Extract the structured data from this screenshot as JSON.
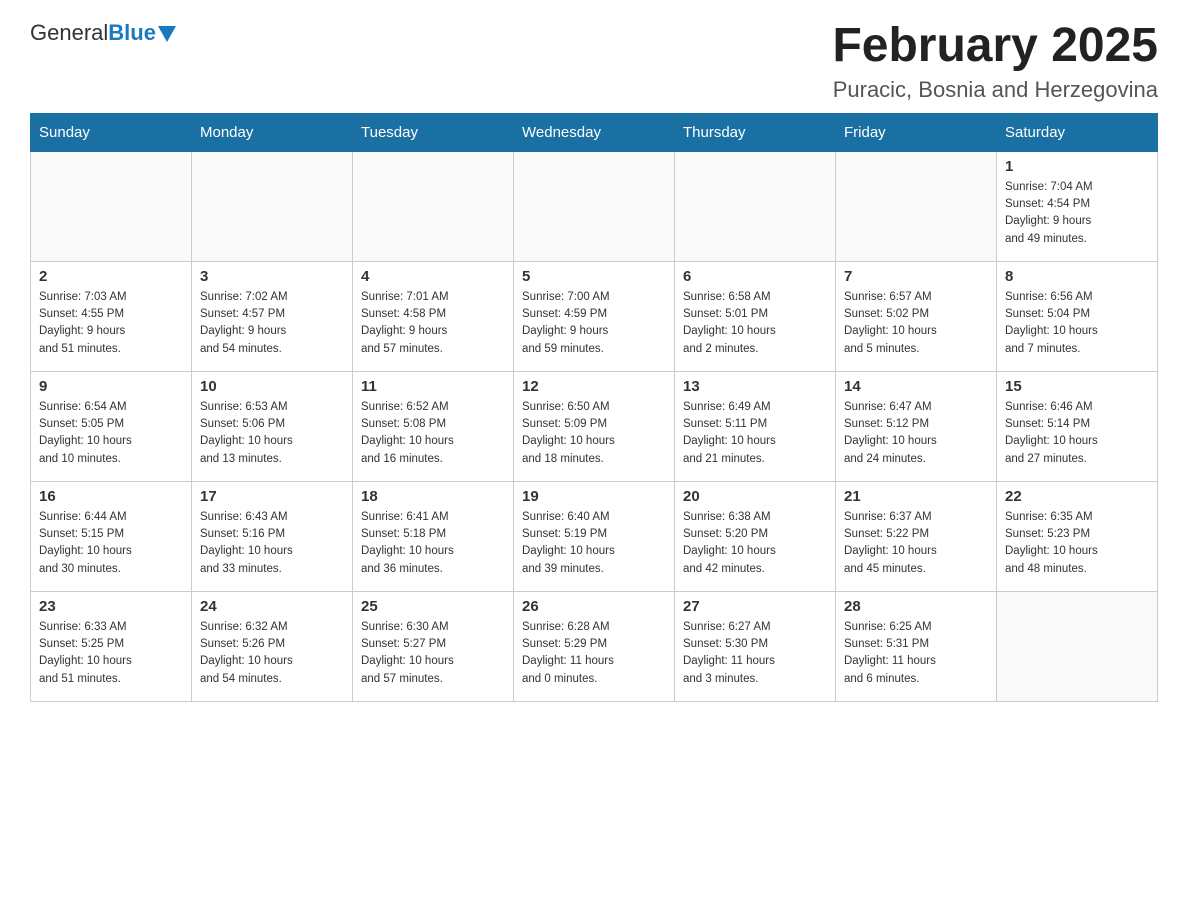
{
  "header": {
    "logo_general": "General",
    "logo_blue": "Blue",
    "title": "February 2025",
    "subtitle": "Puracic, Bosnia and Herzegovina"
  },
  "days_of_week": [
    "Sunday",
    "Monday",
    "Tuesday",
    "Wednesday",
    "Thursday",
    "Friday",
    "Saturday"
  ],
  "weeks": [
    {
      "days": [
        {
          "number": "",
          "info": ""
        },
        {
          "number": "",
          "info": ""
        },
        {
          "number": "",
          "info": ""
        },
        {
          "number": "",
          "info": ""
        },
        {
          "number": "",
          "info": ""
        },
        {
          "number": "",
          "info": ""
        },
        {
          "number": "1",
          "info": "Sunrise: 7:04 AM\nSunset: 4:54 PM\nDaylight: 9 hours\nand 49 minutes."
        }
      ]
    },
    {
      "days": [
        {
          "number": "2",
          "info": "Sunrise: 7:03 AM\nSunset: 4:55 PM\nDaylight: 9 hours\nand 51 minutes."
        },
        {
          "number": "3",
          "info": "Sunrise: 7:02 AM\nSunset: 4:57 PM\nDaylight: 9 hours\nand 54 minutes."
        },
        {
          "number": "4",
          "info": "Sunrise: 7:01 AM\nSunset: 4:58 PM\nDaylight: 9 hours\nand 57 minutes."
        },
        {
          "number": "5",
          "info": "Sunrise: 7:00 AM\nSunset: 4:59 PM\nDaylight: 9 hours\nand 59 minutes."
        },
        {
          "number": "6",
          "info": "Sunrise: 6:58 AM\nSunset: 5:01 PM\nDaylight: 10 hours\nand 2 minutes."
        },
        {
          "number": "7",
          "info": "Sunrise: 6:57 AM\nSunset: 5:02 PM\nDaylight: 10 hours\nand 5 minutes."
        },
        {
          "number": "8",
          "info": "Sunrise: 6:56 AM\nSunset: 5:04 PM\nDaylight: 10 hours\nand 7 minutes."
        }
      ]
    },
    {
      "days": [
        {
          "number": "9",
          "info": "Sunrise: 6:54 AM\nSunset: 5:05 PM\nDaylight: 10 hours\nand 10 minutes."
        },
        {
          "number": "10",
          "info": "Sunrise: 6:53 AM\nSunset: 5:06 PM\nDaylight: 10 hours\nand 13 minutes."
        },
        {
          "number": "11",
          "info": "Sunrise: 6:52 AM\nSunset: 5:08 PM\nDaylight: 10 hours\nand 16 minutes."
        },
        {
          "number": "12",
          "info": "Sunrise: 6:50 AM\nSunset: 5:09 PM\nDaylight: 10 hours\nand 18 minutes."
        },
        {
          "number": "13",
          "info": "Sunrise: 6:49 AM\nSunset: 5:11 PM\nDaylight: 10 hours\nand 21 minutes."
        },
        {
          "number": "14",
          "info": "Sunrise: 6:47 AM\nSunset: 5:12 PM\nDaylight: 10 hours\nand 24 minutes."
        },
        {
          "number": "15",
          "info": "Sunrise: 6:46 AM\nSunset: 5:14 PM\nDaylight: 10 hours\nand 27 minutes."
        }
      ]
    },
    {
      "days": [
        {
          "number": "16",
          "info": "Sunrise: 6:44 AM\nSunset: 5:15 PM\nDaylight: 10 hours\nand 30 minutes."
        },
        {
          "number": "17",
          "info": "Sunrise: 6:43 AM\nSunset: 5:16 PM\nDaylight: 10 hours\nand 33 minutes."
        },
        {
          "number": "18",
          "info": "Sunrise: 6:41 AM\nSunset: 5:18 PM\nDaylight: 10 hours\nand 36 minutes."
        },
        {
          "number": "19",
          "info": "Sunrise: 6:40 AM\nSunset: 5:19 PM\nDaylight: 10 hours\nand 39 minutes."
        },
        {
          "number": "20",
          "info": "Sunrise: 6:38 AM\nSunset: 5:20 PM\nDaylight: 10 hours\nand 42 minutes."
        },
        {
          "number": "21",
          "info": "Sunrise: 6:37 AM\nSunset: 5:22 PM\nDaylight: 10 hours\nand 45 minutes."
        },
        {
          "number": "22",
          "info": "Sunrise: 6:35 AM\nSunset: 5:23 PM\nDaylight: 10 hours\nand 48 minutes."
        }
      ]
    },
    {
      "days": [
        {
          "number": "23",
          "info": "Sunrise: 6:33 AM\nSunset: 5:25 PM\nDaylight: 10 hours\nand 51 minutes."
        },
        {
          "number": "24",
          "info": "Sunrise: 6:32 AM\nSunset: 5:26 PM\nDaylight: 10 hours\nand 54 minutes."
        },
        {
          "number": "25",
          "info": "Sunrise: 6:30 AM\nSunset: 5:27 PM\nDaylight: 10 hours\nand 57 minutes."
        },
        {
          "number": "26",
          "info": "Sunrise: 6:28 AM\nSunset: 5:29 PM\nDaylight: 11 hours\nand 0 minutes."
        },
        {
          "number": "27",
          "info": "Sunrise: 6:27 AM\nSunset: 5:30 PM\nDaylight: 11 hours\nand 3 minutes."
        },
        {
          "number": "28",
          "info": "Sunrise: 6:25 AM\nSunset: 5:31 PM\nDaylight: 11 hours\nand 6 minutes."
        },
        {
          "number": "",
          "info": ""
        }
      ]
    }
  ]
}
